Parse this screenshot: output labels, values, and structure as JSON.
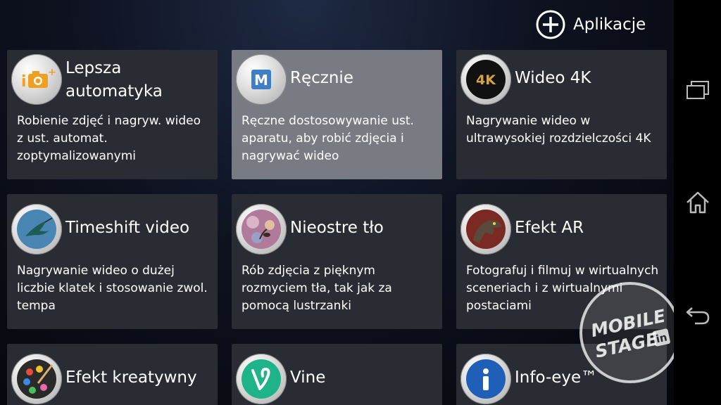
{
  "header": {
    "add_label": "Aplikacje"
  },
  "cards": [
    {
      "title": "Lepsza automatyka",
      "desc": "Robienie zdjęć i nagryw. wideo z ust. automat. zoptymalizowanymi",
      "icon": "superior-auto-icon",
      "selected": false
    },
    {
      "title": "Ręcznie",
      "desc": "Ręczne dostosowywanie ust. aparatu, aby robić zdjęcia i nagrywać wideo",
      "icon": "manual-icon",
      "selected": true
    },
    {
      "title": "Wideo 4K",
      "desc": "Nagrywanie wideo w ultrawysokiej rozdzielczości 4K",
      "icon": "video-4k-icon",
      "selected": false
    },
    {
      "title": "Timeshift video",
      "desc": "Nagrywanie wideo o dużej liczbie klatek i stosowanie zwol. tempa",
      "icon": "hummingbird-icon",
      "selected": false
    },
    {
      "title": "Nieostre tło",
      "desc": "Rób zdjęcia z pięknym rozmyciem tła, tak jak za pomocą lustrzanki",
      "icon": "background-defocus-icon",
      "selected": false
    },
    {
      "title": "Efekt AR",
      "desc": "Fotografuj i filmuj w wirtualnych sceneriach i z wirtualnymi postaciami",
      "icon": "dinosaur-icon",
      "selected": false
    },
    {
      "title": "Efekt kreatywny",
      "desc": "",
      "icon": "palette-icon",
      "selected": false
    },
    {
      "title": "Vine",
      "desc": "",
      "icon": "vine-icon",
      "selected": false
    },
    {
      "title": "Info-eye™",
      "desc": "",
      "icon": "info-eye-icon",
      "selected": false
    }
  ],
  "navbar": {
    "recent": "recent-apps-icon",
    "home": "home-icon",
    "back": "back-icon"
  },
  "watermark": {
    "line1": "MOBILE",
    "line2": "STAGE",
    "suffix": "in"
  }
}
